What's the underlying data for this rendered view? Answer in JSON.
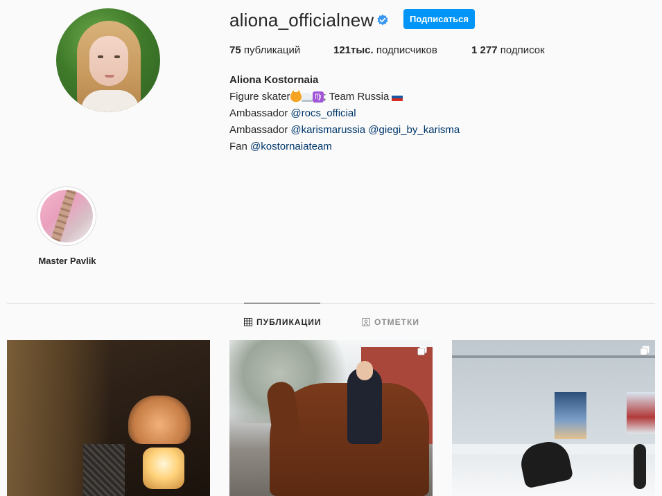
{
  "profile": {
    "username": "aliona_officialnew",
    "follow_label": "Подписаться",
    "verified": true
  },
  "stats": {
    "posts_value": "75",
    "posts_label": "публикаций",
    "followers_value": "121тыс.",
    "followers_label": "подписчиков",
    "following_value": "1 277",
    "following_label": "подписок"
  },
  "bio": {
    "full_name": "Aliona Kostornaia",
    "line1_prefix": "Figure skater",
    "line1_mid": "; Team Russia ",
    "line2_prefix": "Ambassador ",
    "line2_link": "@rocs_official",
    "line3_prefix": "Ambassador ",
    "line3_link1": "@karismarussia",
    "line3_sep": " ",
    "line3_link2": "@giegi_by_karisma",
    "line4_prefix": "Fan ",
    "line4_link": "@kostornaiateam"
  },
  "highlights": [
    {
      "label": "Master Pavlik"
    }
  ],
  "tabs": [
    {
      "label": "ПУБЛИКАЦИИ",
      "active": true,
      "icon": "grid-icon"
    },
    {
      "label": "ОТМЕТКИ",
      "active": false,
      "icon": "tag-person-icon"
    }
  ],
  "posts": [
    {
      "type": "photo",
      "multiple": false
    },
    {
      "type": "photo",
      "multiple": true
    },
    {
      "type": "photo",
      "multiple": true
    }
  ],
  "colors": {
    "accent": "#0095f6",
    "link": "#00376b",
    "background": "#fafafa"
  }
}
